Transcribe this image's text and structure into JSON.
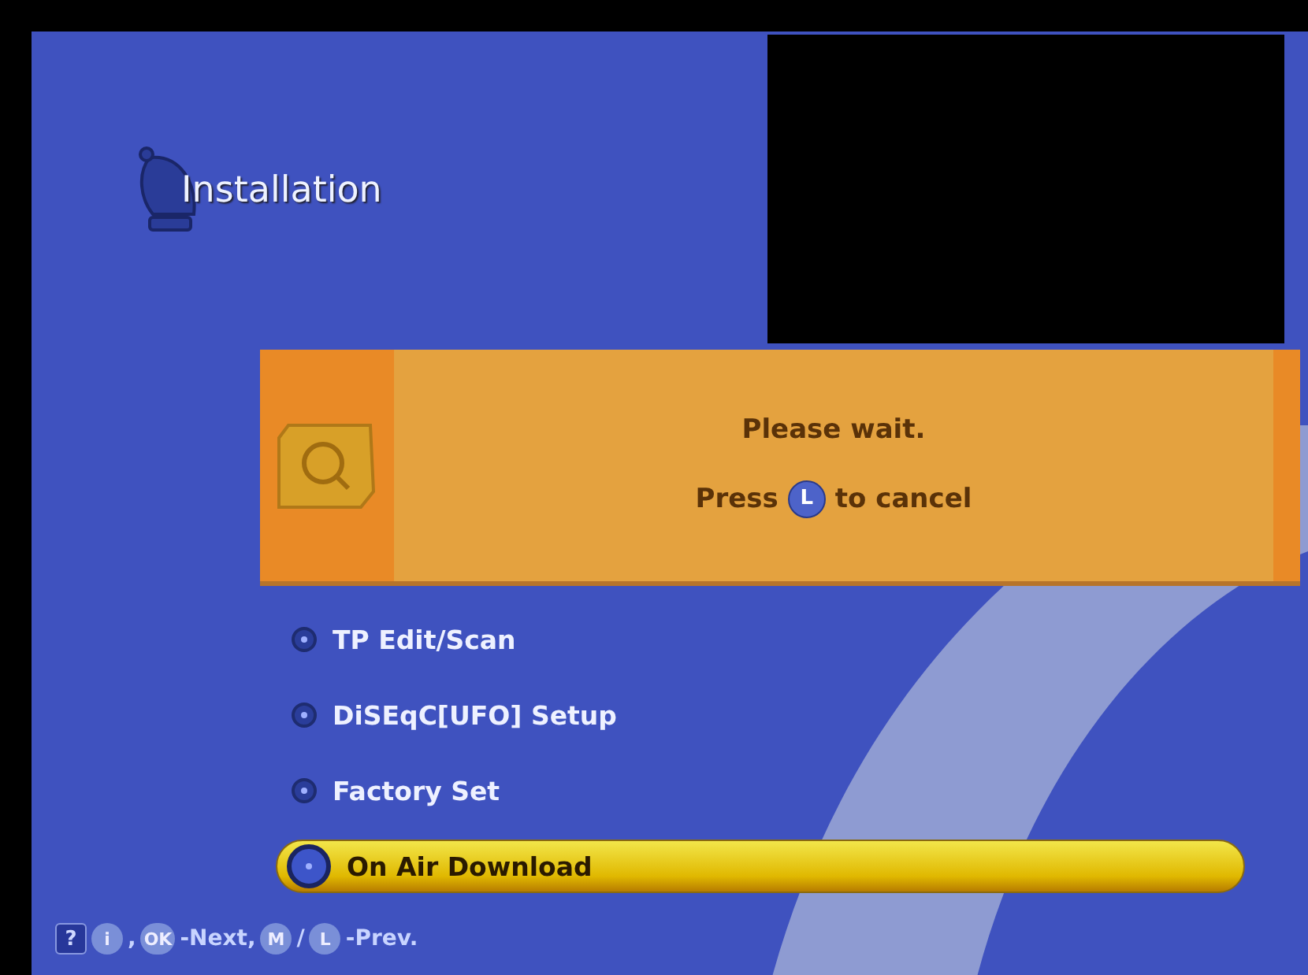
{
  "header": {
    "title": "Installation"
  },
  "dialog": {
    "message": "Please wait.",
    "cancel_prefix": "Press",
    "cancel_key": "L",
    "cancel_suffix": "to cancel"
  },
  "menu": [
    {
      "label": "TP Edit/Scan",
      "selected": false
    },
    {
      "label": "DiSEqC[UFO] Setup",
      "selected": false
    },
    {
      "label": "Factory Set",
      "selected": false
    },
    {
      "label": "On Air Download",
      "selected": true
    }
  ],
  "footer": [
    {
      "kind": "help",
      "text": "?"
    },
    {
      "kind": "key",
      "text": "i"
    },
    {
      "kind": "text",
      "text": ","
    },
    {
      "kind": "key",
      "text": "OK"
    },
    {
      "kind": "text",
      "text": "-Next,"
    },
    {
      "kind": "key",
      "text": "M"
    },
    {
      "kind": "text",
      "text": "/"
    },
    {
      "kind": "key",
      "text": "L"
    },
    {
      "kind": "text",
      "text": "-Prev."
    }
  ]
}
